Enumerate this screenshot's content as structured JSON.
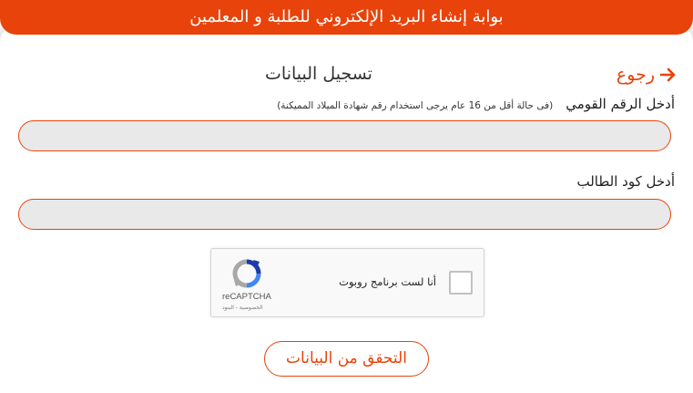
{
  "header": {
    "title": "بوابة إنشاء البريد الإلكتروني للطلبة و المعلمين"
  },
  "nav": {
    "back_label": "رجوع"
  },
  "form": {
    "title": "تسجيل البيانات",
    "national_id": {
      "label": "أدخل الرقم القومي",
      "hint": "(فى حالة أقل من 16 عام يرجى استخدام رقم شهادة الميلاد المميكنة)",
      "value": ""
    },
    "student_code": {
      "label": "أدخل كود الطالب",
      "value": ""
    },
    "submit_label": "التحقق من البيانات"
  },
  "captcha": {
    "label": "أنا لست برنامج روبوت",
    "brand": "reCAPTCHA",
    "links": "الخصوصية - البنود"
  },
  "colors": {
    "accent": "#e8430a",
    "input_bg": "#e9e9e9"
  }
}
